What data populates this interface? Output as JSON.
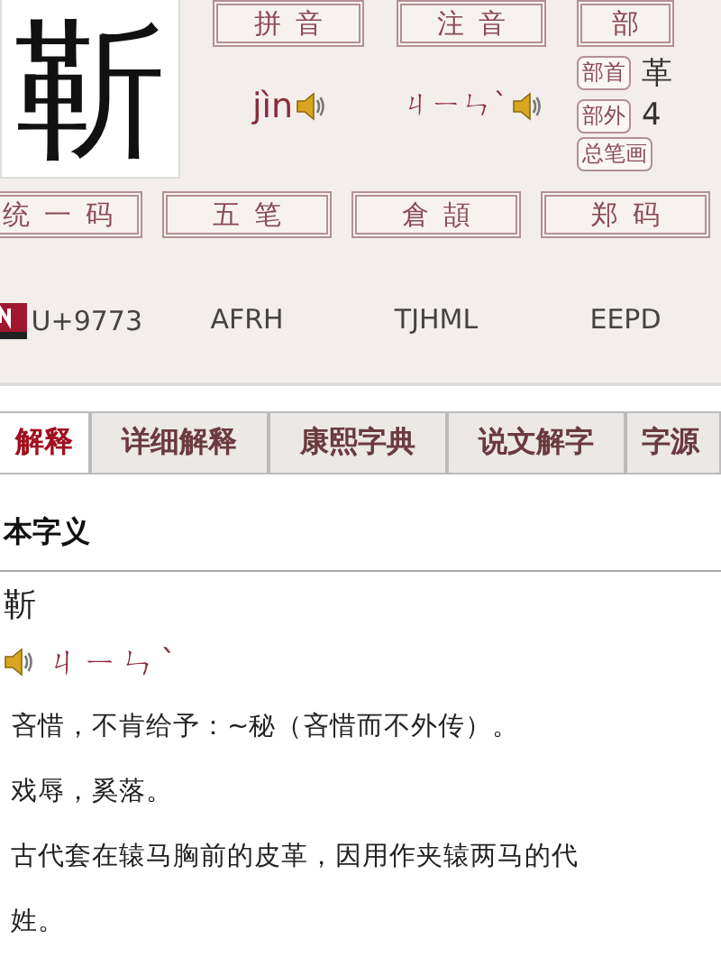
{
  "character": {
    "glyph": "靳"
  },
  "pronunciations": [
    {
      "kind": "pinyin",
      "label": "拼音",
      "value": "jìn"
    },
    {
      "kind": "zhuyin",
      "label": "注音",
      "value": "ㄐㄧㄣˋ"
    }
  ],
  "parts": {
    "label": "部",
    "rows": [
      {
        "label": "部首",
        "value": "革"
      },
      {
        "label": "部外",
        "value": "4"
      },
      {
        "label": "总笔画"
      }
    ]
  },
  "codes": [
    {
      "kind": "unicode",
      "label": "统一码",
      "value": "U+9773"
    },
    {
      "kind": "plain",
      "label": "五笔",
      "value": "AFRH"
    },
    {
      "kind": "plain",
      "label": "倉頡",
      "value": "TJHML"
    },
    {
      "kind": "plain",
      "label": "郑码",
      "value": "EEPD"
    }
  ],
  "tabs": [
    {
      "label": "解释",
      "selected": true
    },
    {
      "label": "详细解释",
      "selected": false
    },
    {
      "label": "康熙字典",
      "selected": false
    },
    {
      "label": "说文解字",
      "selected": false
    },
    {
      "label": "字源",
      "selected": false
    }
  ],
  "section_title": "本字义",
  "entry": {
    "glyph": "靳",
    "zhuyin": "ㄐㄧㄣˋ"
  },
  "definitions": [
    "吝惜，不肯给予：~秘（吝惜而不外传）。",
    "戏辱，奚落。",
    "古代套在辕马胸前的皮革，因用作夹辕两马的代",
    "姓。"
  ]
}
